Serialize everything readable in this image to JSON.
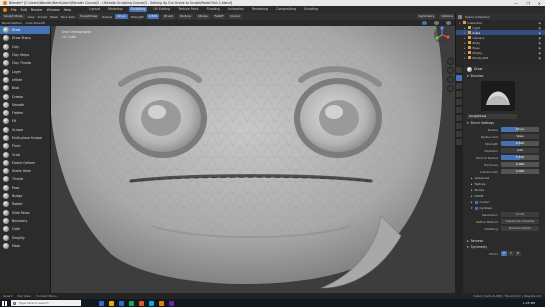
{
  "window": {
    "title": "Blender* [C:\\Users\\Wonder\\Nerd\\Learn\\Blender Course\\2 - Ultimate Sculpting Course\\3 - Setting Up Our Scene to Sculpt\\Model Fish 2.blend]",
    "controls": [
      "—",
      "❐",
      "✕"
    ]
  },
  "menubar": {
    "menus": [
      "File",
      "Edit",
      "Render",
      "Window",
      "Help"
    ],
    "workspaces": [
      "Layout",
      "Modeling",
      "Sculpting",
      "UV Editing",
      "Texture Paint",
      "Shading",
      "Animation",
      "Rendering",
      "Compositing",
      "Scripting"
    ],
    "active_workspace": "Sculpting"
  },
  "viewport_header": {
    "mode": "Sculpt Mode",
    "menus": [
      "View",
      "Sculpt",
      "Mask",
      "Face Sets"
    ],
    "brush_name": "SculptDraw",
    "radius_label": "Radius",
    "radius_value": "40 px",
    "strength_label": "Strength",
    "strength_value": "0.500",
    "extra": [
      "Brush",
      "Texture",
      "Stroke",
      "Falloff",
      "Cursor"
    ],
    "right_items": [
      "Symmetry",
      "Options"
    ]
  },
  "viewport_header2": {
    "items": [
      "Brush Radius",
      "Auto Smooth"
    ]
  },
  "viewport": {
    "info_line1": "User Orthographic",
    "info_line2": "(1) Cube"
  },
  "brushes": [
    {
      "label": "Draw",
      "active": true
    },
    {
      "label": "Draw Sharp"
    },
    {
      "label": "Clay"
    },
    {
      "label": "Clay Strips"
    },
    {
      "label": "Clay Thumb"
    },
    {
      "label": "Layer"
    },
    {
      "label": "Inflate"
    },
    {
      "label": "Blob"
    },
    {
      "label": "Crease"
    },
    {
      "label": "Smooth"
    },
    {
      "label": "Flatten"
    },
    {
      "label": "Fill"
    },
    {
      "label": "Scrape"
    },
    {
      "label": "Multi-plane Scrape"
    },
    {
      "label": "Pinch"
    },
    {
      "label": "Grab"
    },
    {
      "label": "Elastic Deform"
    },
    {
      "label": "Snake Hook"
    },
    {
      "label": "Thumb"
    },
    {
      "label": "Pose"
    },
    {
      "label": "Nudge"
    },
    {
      "label": "Rotate"
    },
    {
      "label": "Slide Relax"
    },
    {
      "label": "Boundary"
    },
    {
      "label": "Cloth"
    },
    {
      "label": "Simplify"
    },
    {
      "label": "Mask"
    }
  ],
  "outliner": {
    "header": "Scene Collection",
    "rows": [
      {
        "label": "Collection",
        "indent": 0
      },
      {
        "label": "Light",
        "indent": 1
      },
      {
        "label": "Cube",
        "indent": 1,
        "selected": true
      },
      {
        "label": "Camera",
        "indent": 1
      },
      {
        "label": "Body",
        "indent": 1
      },
      {
        "label": "Eyes",
        "indent": 1
      },
      {
        "label": "Empty",
        "indent": 1
      },
      {
        "label": "Empty.001",
        "indent": 1
      }
    ]
  },
  "properties": {
    "tool_name": "Draw",
    "brushes_section": "Brushes",
    "brush_datablock": "SculptDraw",
    "brush_settings_section": "Brush Settings",
    "rows": [
      {
        "label": "Radius",
        "value": "40 px",
        "fill": 0.45
      },
      {
        "label": "Radius Unit",
        "value": "View"
      },
      {
        "label": "Strength",
        "value": "0.500",
        "fill": 0.5
      },
      {
        "label": "Direction",
        "value": "Add"
      },
      {
        "label": "Normal Radius",
        "value": "0.500",
        "fill": 0.5
      },
      {
        "label": "Hardness",
        "value": "0.000",
        "fill": 0.0
      },
      {
        "label": "Autosmooth",
        "value": "0.000",
        "fill": 0.0
      }
    ],
    "subsections": [
      "Advanced",
      "Texture",
      "Stroke",
      "Falloff",
      "Cursor",
      "Dyntopo"
    ],
    "dyntopo_rows": [
      {
        "label": "Resolution",
        "value": "12.00"
      },
      {
        "label": "Refine Method",
        "value": "Subdivide Collapse"
      },
      {
        "label": "Detailing",
        "value": "Relative Detail"
      }
    ],
    "bottom_sections": [
      "Remesh",
      "Symmetry"
    ],
    "mirror_label": "Mirror",
    "mirror_axes": [
      "X",
      "Y",
      "Z"
    ]
  },
  "statusbar": {
    "items": [
      "Select",
      "Pan View",
      "Context Menu"
    ],
    "stats": "Cube | Verts:6,038 | Tris:12,072 | Objects:1/3"
  },
  "taskbar": {
    "search_placeholder": "Type here to search",
    "clock": "1:25 PM",
    "icon_colors": [
      "#2b6fd6",
      "#f6a700",
      "#2b6fd6",
      "#20a352",
      "#e4572e",
      "#0ea5e9",
      "#e87d0d",
      "#6b21a8"
    ]
  }
}
